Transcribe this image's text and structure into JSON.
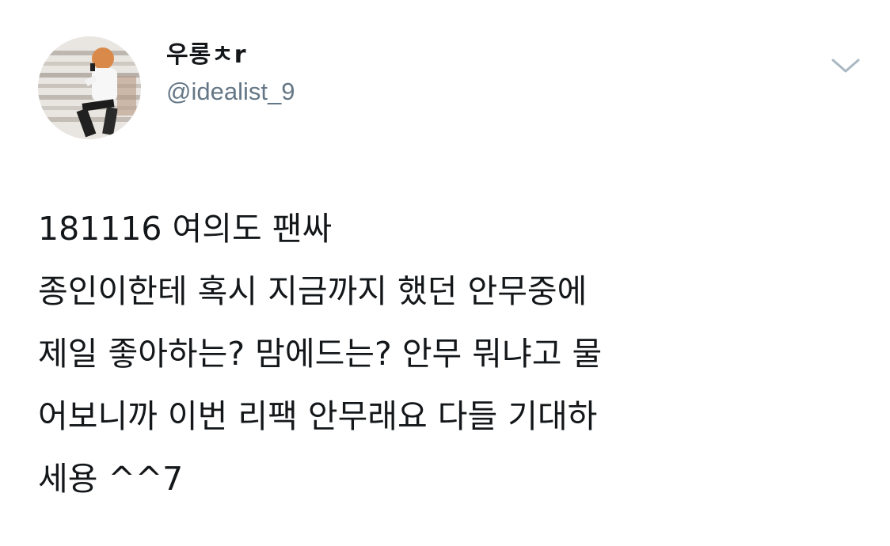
{
  "user": {
    "display_name": "우롱ㅊr",
    "handle": "@idealist_9"
  },
  "icons": {
    "avatar": "profile-photo-performer-with-microphone",
    "menu": "chevron-down-icon"
  },
  "colors": {
    "text": "#14171a",
    "secondary": "#657786",
    "caret": "#aab8c2"
  },
  "tweet": {
    "lines": [
      "181116 여의도 팬싸",
      "종인이한테 혹시 지금까지 했던 안무중에",
      "제일 좋아하는? 맘에드는? 안무 뭐냐고 물",
      "어보니까 이번 리팩 안무래요 다들 기대하",
      "세용 ^^7"
    ]
  }
}
